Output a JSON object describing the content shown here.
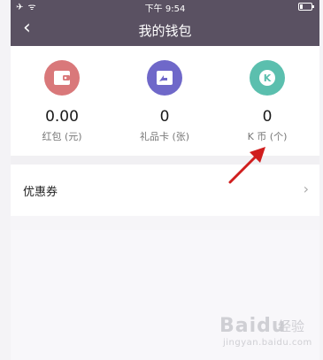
{
  "status_bar": {
    "left_icons": "✈ ᯤ",
    "time": "下午 9:54"
  },
  "nav": {
    "back_glyph": "‹",
    "title": "我的钱包"
  },
  "wallet": {
    "items": [
      {
        "value": "0.00",
        "label": "红包 (元)",
        "icon": "wallet-icon",
        "color": "#d9787a"
      },
      {
        "value": "0",
        "label": "礼品卡 (张)",
        "icon": "gift-card-icon",
        "color": "#6f68c9"
      },
      {
        "value": "0",
        "label": "K 币 (个)",
        "icon": "k-coin-icon",
        "color": "#5bbfae"
      }
    ]
  },
  "coupon": {
    "label": "优惠券",
    "chevron": "›"
  },
  "watermark": {
    "brand": "Baidu",
    "suffix": "经验",
    "url": "jingyan.baidu.com"
  }
}
